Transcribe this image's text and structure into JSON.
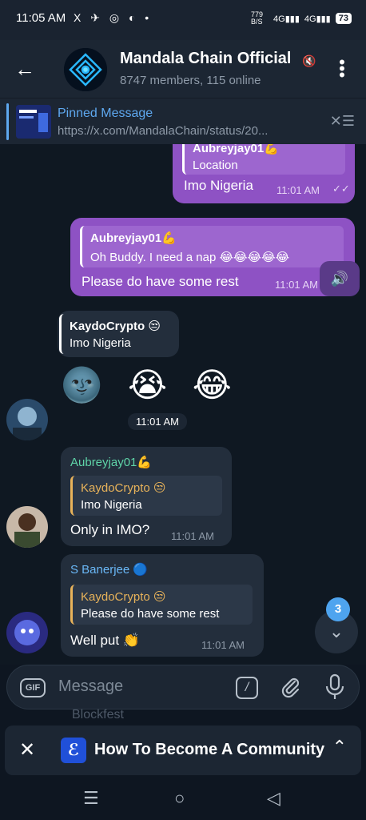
{
  "status_bar": {
    "time": "11:05 AM",
    "icons": "X ✈ ◎ ◐ •",
    "network": "779 B/S",
    "signal1": "4G",
    "signal2": "4G",
    "battery": "73"
  },
  "header": {
    "title": "Mandala Chain Official",
    "subtitle": "8747 members, 115 online"
  },
  "pinned": {
    "title": "Pinned Message",
    "url": "https://x.com/MandalaChain/status/20..."
  },
  "messages": {
    "m1": {
      "reply_name": "Aubreyjay01💪",
      "reply_text": "Location",
      "text": "Imo Nigeria",
      "time": "11:01 AM"
    },
    "m2": {
      "reply_name": "Aubreyjay01💪",
      "reply_text": "Oh Buddy. I need a nap 😂😂😂😂😂",
      "text": "Please do have some rest",
      "time": "11:01 AM"
    },
    "m3": {
      "reply_name": "KaydoCrypto 😒",
      "reply_text": "Imo Nigeria",
      "emojis": "🌚 😭 😂",
      "time": "11:01 AM"
    },
    "m4": {
      "sender": "Aubreyjay01💪",
      "reply_name": "KaydoCrypto 😒",
      "reply_text": "Imo Nigeria",
      "text": "Only in IMO?",
      "time": "11:01 AM"
    },
    "m5": {
      "sender": "S Banerjee 🔵",
      "reply_name": "KaydoCrypto 😒",
      "reply_text": "Please do have some rest",
      "text": "Well put 👏",
      "time": "11:01 AM"
    }
  },
  "input": {
    "gif_label": "GIF",
    "placeholder": "Message",
    "cmd_label": "/"
  },
  "hint_text": "Blockfest",
  "unread_count": "3",
  "banner": {
    "title": "How To Become A Community"
  },
  "colors": {
    "outgoing": "#8e52c4",
    "incoming": "#232e3c",
    "accent": "#5ea8ef"
  }
}
